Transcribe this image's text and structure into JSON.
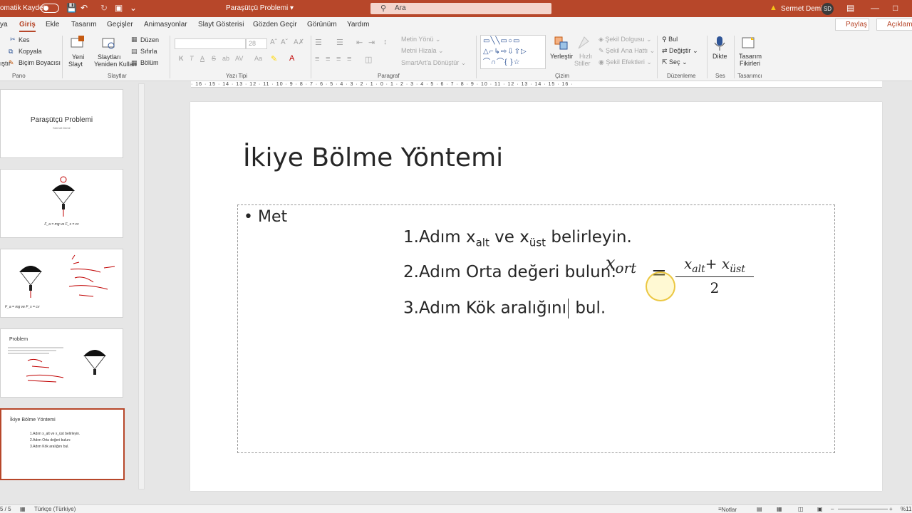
{
  "titlebar": {
    "autosave_label": "omatik Kaydet",
    "document_title": "Paraşütçü Problemi",
    "search_placeholder": "Ara",
    "user_name": "Sermet Demir",
    "user_initials": "SD",
    "accent": "#b7472a"
  },
  "tabs": {
    "items": [
      "ya",
      "Giriş",
      "Ekle",
      "Tasarım",
      "Geçişler",
      "Animasyonlar",
      "Slayt Gösterisi",
      "Gözden Geçir",
      "Görünüm",
      "Yardım"
    ],
    "active": "Giriş",
    "share_label": "Paylaş",
    "comments_label": "Açıklama"
  },
  "ribbon": {
    "pano": {
      "cut": "Kes",
      "copy": "Kopyala",
      "format_painter": "Biçim Boyacısı",
      "paste_fragment": "ıştır",
      "group": "Pano"
    },
    "slides": {
      "new_slide": [
        "Yeni",
        "Slayt"
      ],
      "reuse": [
        "Slaytları",
        "Yeniden Kullan"
      ],
      "layout": "Düzen",
      "reset": "Sıfırla",
      "section": "Bölüm",
      "group": "Slaytlar"
    },
    "font": {
      "size": "28",
      "group": "Yazı Tipi",
      "bold": "K",
      "italic": "T",
      "underline": "A",
      "strike": "S",
      "shadow": "ab",
      "spacing": "AV"
    },
    "paragraph": {
      "text_direction": "Metin Yönü",
      "align_text": "Metni Hizala",
      "smartart": "SmartArt'a Dönüştür",
      "group": "Paragraf"
    },
    "drawing": {
      "arrange": "Yerleştir",
      "quick_styles": [
        "Hızlı",
        "Stiller"
      ],
      "fill": "Şekil Dolgusu",
      "outline": "Şekil Ana Hattı",
      "effects": "Şekil Efektleri",
      "group": "Çizim"
    },
    "editing": {
      "find": "Bul",
      "replace": "Değiştir",
      "select": "Seç",
      "group": "Düzenleme"
    },
    "voice": {
      "dictate": "Dikte",
      "group": "Ses"
    },
    "designer": {
      "ideas": [
        "Tasarım",
        "Fikirleri"
      ],
      "group": "Tasarımcı"
    }
  },
  "thumbnails": [
    {
      "title": "Paraşütçü Problemi",
      "subtitle": "Sermet Demir"
    },
    {
      "formula": "F_a = mg  ve  F_s = cv"
    },
    {
      "formula": "F_a = mg  ve  F_s = cv"
    },
    {
      "title": "Problem"
    },
    {
      "title": "İkiye Bölme Yöntemi",
      "lines": [
        "1.Adım x_alt ve x_üst belirleyin.",
        "2.Adım Orta değeri bulun:",
        "3.Adım Kök aralığını bul."
      ]
    }
  ],
  "ruler": {
    "horizontal": "· 16 · 15 · 14 · 13 · 12 · 11 · 10 · 9 · 8 · 7 · 6 · 5 · 4 · 3 · 2 · 1 · 0 · 1 · 2 · 3 · 4 · 5 · 6 · 7 · 8 · 9 · 10 · 11 · 12 · 13 · 14 · 15 · 16 ·"
  },
  "slide": {
    "title": "İkiye Bölme Yöntemi",
    "bullet": "• Met",
    "step1": {
      "prefix": "1.Adım x",
      "sub1": "alt",
      "mid": " ve x",
      "sub2": "üst",
      "suffix": " belirleyin."
    },
    "step2": {
      "text": "2.Adım Orta değeri bulun:"
    },
    "step3": {
      "before_caret": "3.Adım Kök aralığını",
      "after_caret": " bul."
    },
    "formula": {
      "lhs": "x",
      "lhs_sub": "ort",
      "equals": "=",
      "num_a": "x",
      "num_a_sub": "alt",
      "plus": "+",
      "num_b": "x",
      "num_b_sub": "üst",
      "den": "2"
    }
  },
  "status": {
    "slide_counter": "5 / 5",
    "language": "Türkçe (Türkiye)",
    "notes": "Notlar",
    "zoom": "%11"
  }
}
